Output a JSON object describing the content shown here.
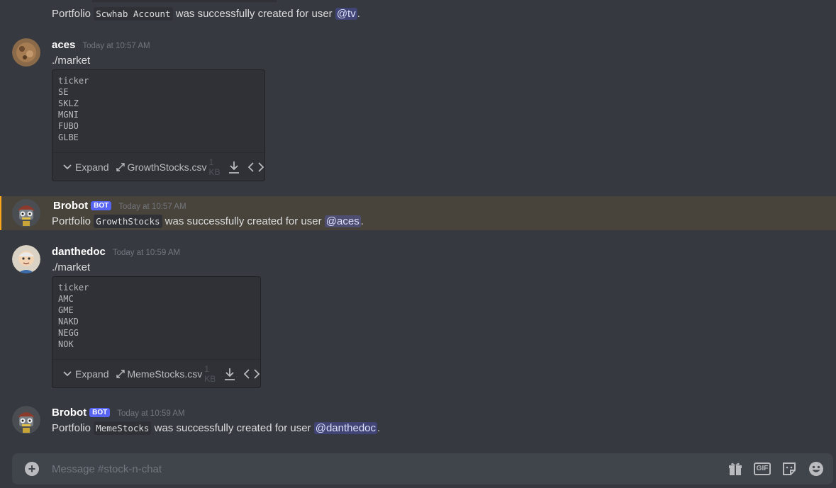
{
  "messages": [
    {
      "continued": true,
      "text_before": "Portfolio ",
      "code": "Scwhab Account",
      "text_after": " was successfully created for user ",
      "mention": "@tv",
      "end": "."
    },
    {
      "username": "aces",
      "timestamp": "Today at 10:57 AM",
      "text": "./market",
      "attachment": {
        "lines": "ticker\nSE\nSKLZ\nMGNI\nFUBO\nGLBE",
        "expand_label": "Expand",
        "filename": "GrowthStocks.csv",
        "size": "1 KB"
      }
    },
    {
      "username": "Brobot",
      "bot_tag": "BOT",
      "timestamp": "Today at 10:57 AM",
      "text_before": "Portfolio ",
      "code": "GrowthStocks",
      "text_after": " was successfully created for user ",
      "mention": "@aces",
      "end": "."
    },
    {
      "username": "danthedoc",
      "timestamp": "Today at 10:59 AM",
      "text": "./market",
      "attachment": {
        "lines": "ticker\nAMC\nGME\nNAKD\nNEGG\nNOK",
        "expand_label": "Expand",
        "filename": "MemeStocks.csv",
        "size": "1 KB"
      }
    },
    {
      "username": "Brobot",
      "bot_tag": "BOT",
      "timestamp": "Today at 10:59 AM",
      "text_before": "Portfolio ",
      "code": "MemeStocks",
      "text_after": " was successfully created for user ",
      "mention": "@danthedoc",
      "end": "."
    }
  ],
  "composer": {
    "placeholder": "Message #stock-n-chat",
    "gif_label": "GIF"
  },
  "icons": {
    "avatar_aces": "avatar-aces",
    "avatar_brobot": "avatar-brobot-robot",
    "avatar_danthedoc": "avatar-danthedoc",
    "attach": "plus-circle-icon",
    "gift": "gift-icon",
    "gif": "gif-icon",
    "sticker": "sticker-icon",
    "emoji": "emoji-icon",
    "expand": "chevron-down-icon",
    "open": "expand-arrows-icon",
    "download": "download-icon",
    "code": "code-icon"
  },
  "colors": {
    "background": "#36393f",
    "mention_highlight": "#faa81a",
    "bot_tag": "#5865f2",
    "composer": "#40444b"
  }
}
